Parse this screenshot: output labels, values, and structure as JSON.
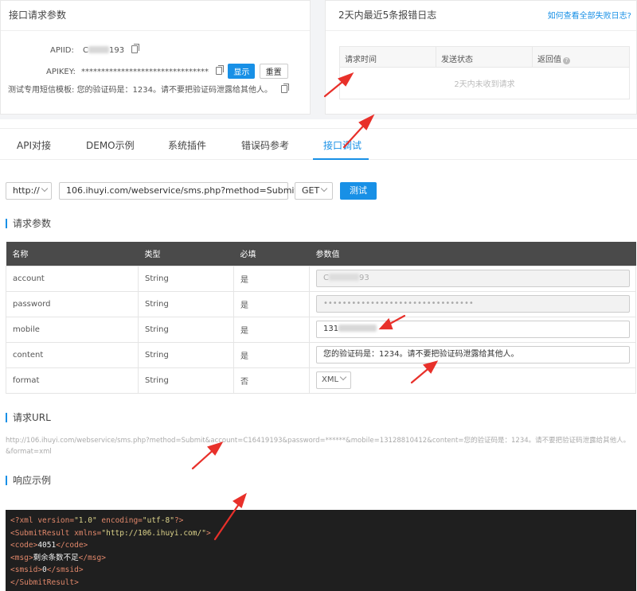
{
  "left_panel": {
    "title": "接口请求参数",
    "apiid_label": "APIID:",
    "apiid_prefix": "C",
    "apiid_suffix": "193",
    "apikey_label": "APIKEY:",
    "apikey_value": "********************************",
    "show_button": "显示",
    "reset_button": "重置",
    "template_label": "测试专用短信模板:",
    "template_value": "您的验证码是：1234。请不要把验证码泄露给其他人。"
  },
  "right_panel": {
    "title": "2天内最近5条报错日志",
    "help_link": "如何查看全部失败日志?",
    "columns": [
      "请求时间",
      "发送状态",
      "返回值"
    ],
    "empty_text": "2天内未收到请求"
  },
  "tabs": [
    "API对接",
    "DEMO示例",
    "系统插件",
    "错误码参考",
    "接口调试"
  ],
  "request": {
    "protocol": "http://",
    "url": "106.ihuyi.com/webservice/sms.php?method=Submit",
    "method": "GET",
    "test_button": "测试"
  },
  "params_section": "请求参数",
  "params": {
    "headers": [
      "名称",
      "类型",
      "必填",
      "参数值"
    ],
    "rows": [
      {
        "name": "account",
        "type": "String",
        "required": "是",
        "value": "C",
        "value_suffix": "93"
      },
      {
        "name": "password",
        "type": "String",
        "required": "是",
        "value": "••••••••••••••••••••••••••••••••"
      },
      {
        "name": "mobile",
        "type": "String",
        "required": "是",
        "value": "131"
      },
      {
        "name": "content",
        "type": "String",
        "required": "是",
        "value": "您的验证码是：1234。请不要把验证码泄露给其他人。"
      },
      {
        "name": "format",
        "type": "String",
        "required": "否",
        "value": "XML"
      }
    ]
  },
  "url_section": "请求URL",
  "request_url": "http://106.ihuyi.com/webservice/sms.php?method=Submit&account=C16419193&password=******&mobile=13128810412&content=您的验证码是：1234。请不要把验证码泄露给其他人。&format=xml",
  "response_section": "响应示例",
  "response": {
    "l1_a": "<?xml version=",
    "l1_b": "\"1.0\"",
    "l1_c": " encoding=",
    "l1_d": "\"utf-8\"",
    "l1_e": "?>",
    "l2_a": "<SubmitResult xmlns=",
    "l2_b": "\"http://106.ihuyi.com/\"",
    "l2_c": ">",
    "code_open": "<code>",
    "code_value": "4051",
    "code_close": "</code>",
    "msg_open": "<msg>",
    "msg_value": "剩余条数不足",
    "msg_close": "</msg>",
    "smsid_open": "<smsid>",
    "smsid_value": "0",
    "smsid_close": "</smsid>",
    "close_root": "</SubmitResult>"
  },
  "colors": {
    "accent": "#1890e6",
    "arrow": "#e8302a",
    "code_bg": "#1f1f1f"
  }
}
